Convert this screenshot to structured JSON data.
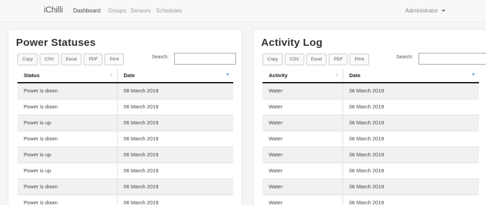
{
  "nav": {
    "brand": "iChilli",
    "items": [
      {
        "label": "Dashboard",
        "active": true
      },
      {
        "label": "Groups",
        "active": false
      },
      {
        "label": "Sensors",
        "active": false
      },
      {
        "label": "Schedules",
        "active": false
      }
    ],
    "user": "Administrator"
  },
  "power": {
    "title": "Power Statuses",
    "buttons": [
      "Copy",
      "CSV",
      "Excel",
      "PDF",
      "Print"
    ],
    "search_label": "Search:",
    "search_value": "",
    "columns": [
      "Status",
      "Date"
    ],
    "rows": [
      [
        "Power is down",
        "08 March 2019"
      ],
      [
        "Power is down",
        "06 March 2019"
      ],
      [
        "Power is up",
        "06 March 2019"
      ],
      [
        "Power is down",
        "06 March 2019"
      ],
      [
        "Power is up",
        "06 March 2019"
      ],
      [
        "Power is up",
        "06 March 2019"
      ],
      [
        "Power is down",
        "06 March 2019"
      ],
      [
        "Power is down",
        "06 March 2019"
      ]
    ]
  },
  "activity": {
    "title": "Activity Log",
    "buttons": [
      "Copy",
      "CSV",
      "Excel",
      "PDF",
      "Print"
    ],
    "search_label": "Search:",
    "search_value": "",
    "columns": [
      "Activity",
      "Date"
    ],
    "rows": [
      [
        "Water",
        "06 March 2019"
      ],
      [
        "Water",
        "06 March 2019"
      ],
      [
        "Water",
        "06 March 2019"
      ],
      [
        "Water",
        "06 March 2019"
      ],
      [
        "Water",
        "06 March 2019"
      ],
      [
        "Water",
        "06 March 2019"
      ],
      [
        "Water",
        "06 March 2019"
      ],
      [
        "Water",
        "06 March 2019"
      ]
    ]
  },
  "icons": {
    "sort_both": "sort-icon",
    "sort_desc": "sort-desc-icon",
    "dropdown": "caret-down-icon"
  },
  "colors": {
    "accent": "#5b8cc8",
    "striped_row": "#f1f1f1",
    "header_rule": "#222222"
  }
}
